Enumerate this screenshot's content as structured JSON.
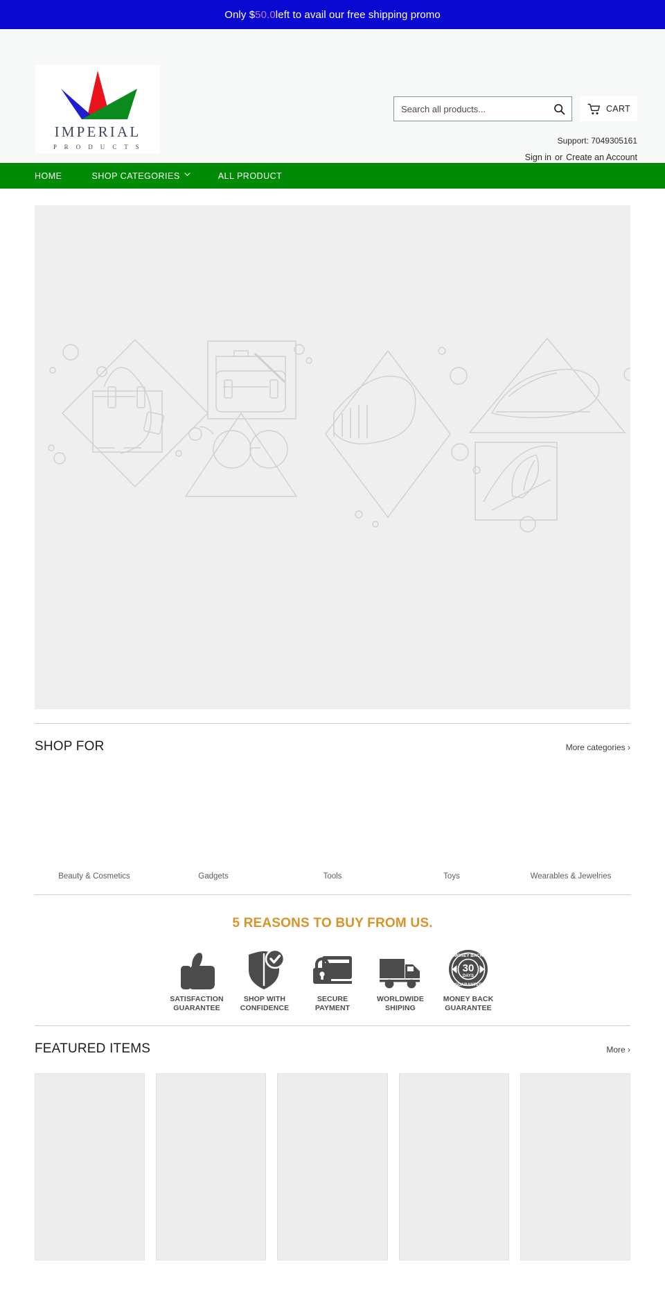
{
  "promo": {
    "prefix": "Only $",
    "amount": "50.0",
    "suffix": " left to avail our free shipping promo"
  },
  "header": {
    "logo": {
      "wordmark": "IMPERIAL",
      "subtext": "P R O D U C T S",
      "mark_colors": {
        "blue": "#1f1fcf",
        "red": "#e8131b",
        "green": "#0b8a1e"
      }
    },
    "search": {
      "placeholder": "Search all products...",
      "value": "",
      "icon": "search-icon"
    },
    "cart": {
      "label": "CART",
      "icon": "shopping-cart-icon"
    },
    "support_label": "Support: 7049305161",
    "account": {
      "sign_in": "Sign in",
      "separator": "or",
      "create": "Create an Account"
    }
  },
  "nav": {
    "background": "#008a06",
    "items": [
      {
        "label": "HOME",
        "has_dropdown": false
      },
      {
        "label": "SHOP CATEGORIES",
        "has_dropdown": true,
        "icon": "chevron-down-icon"
      },
      {
        "label": "ALL PRODUCT",
        "has_dropdown": false
      }
    ]
  },
  "hero": {
    "placeholder": true,
    "background": "#efefef"
  },
  "shop_for": {
    "title": "SHOP FOR",
    "more_link": "More categories ›",
    "categories": [
      {
        "label": "Beauty & Cosmetics"
      },
      {
        "label": "Gadgets"
      },
      {
        "label": "Tools"
      },
      {
        "label": "Toys"
      },
      {
        "label": "Wearables & Jewelries"
      }
    ]
  },
  "reasons": {
    "title": "5 REASONS TO BUY FROM US.",
    "accent_color": "#d99326",
    "items": [
      {
        "icon": "thumbs-up-icon",
        "line1": "SATISFACTION",
        "line2": "GUARANTEE"
      },
      {
        "icon": "shield-check-icon",
        "line1": "SHOP WITH",
        "line2": "CONFIDENCE"
      },
      {
        "icon": "lock-credit-card-icon",
        "line1": "SECURE",
        "line2": "PAYMENT"
      },
      {
        "icon": "delivery-truck-icon",
        "line1": "WORLDWIDE",
        "line2": "SHIPING"
      },
      {
        "icon": "money-back-badge-icon",
        "line1": "MONEY BACK",
        "line2": "GUARANTEE"
      }
    ]
  },
  "featured": {
    "title": "FEATURED ITEMS",
    "more_link": "More ›",
    "items": [
      {
        "placeholder": true
      },
      {
        "placeholder": true
      },
      {
        "placeholder": true
      },
      {
        "placeholder": true
      },
      {
        "placeholder": true
      }
    ]
  }
}
